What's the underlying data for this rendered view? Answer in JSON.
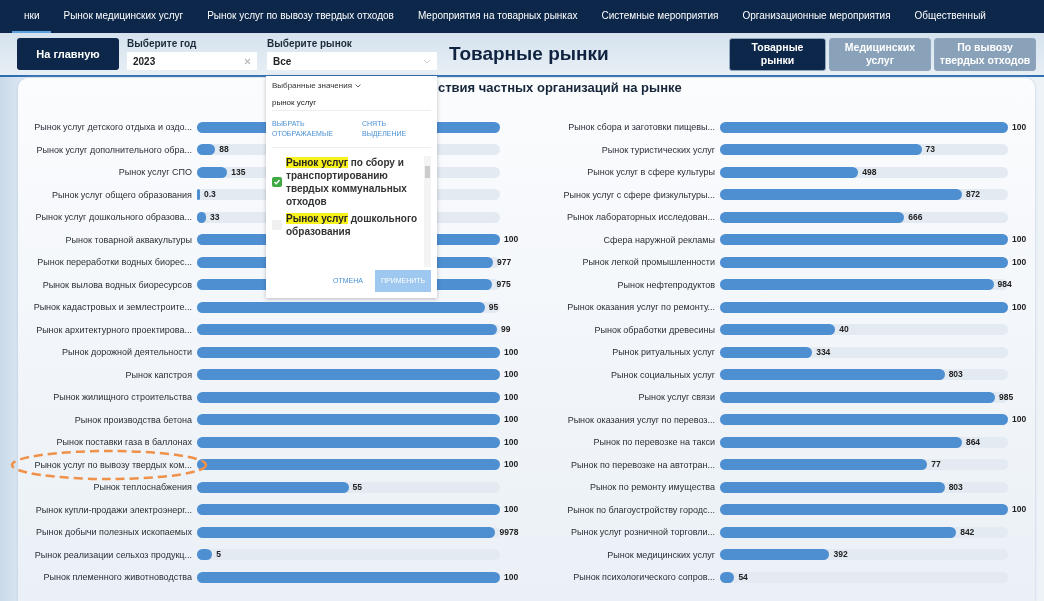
{
  "nav_tabs": [
    {
      "label": "нки",
      "selected": true
    },
    {
      "label": "Рынок медицинских услуг",
      "selected": false
    },
    {
      "label": "Рынок услуг по вывозу твердых отходов",
      "selected": false
    },
    {
      "label": "Мероприятия на товарных рынках",
      "selected": false
    },
    {
      "label": "Системные мероприятия",
      "selected": false
    },
    {
      "label": "Организационные мероприятия",
      "selected": false
    },
    {
      "label": "Общественный",
      "selected": false
    }
  ],
  "home_button": "На главную",
  "year_filter": {
    "label": "Выберите год",
    "value": "2023"
  },
  "market_filter": {
    "label": "Выберите рынок",
    "value": "Все"
  },
  "page_title": "Товарные рынки",
  "view_buttons": [
    {
      "label": "Товарные рынки",
      "selected": true
    },
    {
      "label": "Медицинских услуг",
      "selected": false
    },
    {
      "label": "По вывозу твердых отходов",
      "selected": false
    }
  ],
  "dropdown": {
    "mode": "Выбранные значения",
    "search": "рынок услуг",
    "select_visible": "ВЫБРАТЬ ОТОБРАЖАЕМЫЕ",
    "clear_selection": "СНЯТЬ ВЫДЕЛЕНИЕ",
    "options": [
      {
        "match": "Рынок услуг",
        "text": "по сбору и транспортированию твердых коммунальных отходов",
        "checked": true
      },
      {
        "match": "Рынок услуг",
        "text": "дошкольного образования",
        "checked": false
      }
    ],
    "cancel": "ОТМЕНА",
    "apply": "ПРИМЕНИТЬ",
    "apply_disabled": true
  },
  "chart": {
    "title": "ствия частных организаций на рынке",
    "left_rows": [
      {
        "label": "Рынок услуг детского отдыха и оздо...",
        "value": "",
        "level": 1,
        "highlighted": false
      },
      {
        "label": "Рынок услуг дополнительного обра...",
        "value": "88",
        "level": 0.06,
        "highlighted": false
      },
      {
        "label": "Рынок услуг СПО",
        "value": "135",
        "level": 0.1,
        "highlighted": false
      },
      {
        "label": "Рынок услуг общего образования",
        "value": "0.3",
        "level": 0.01,
        "highlighted": false
      },
      {
        "label": "Рынок услуг дошкольного образова...",
        "value": "33",
        "level": 0.03,
        "highlighted": false
      },
      {
        "label": "Рынок товарной аквакультуры",
        "value": "100",
        "level": 1,
        "highlighted": false
      },
      {
        "label": "Рынок переработки водных биорес...",
        "value": "977",
        "level": 0.977,
        "highlighted": false
      },
      {
        "label": "Рынок вылова водных биоресурсов",
        "value": "975",
        "level": 0.975,
        "highlighted": false
      },
      {
        "label": "Рынок кадастровых и землестроите...",
        "value": "95",
        "level": 0.95,
        "highlighted": false
      },
      {
        "label": "Рынок архитектурного проектирова...",
        "value": "99",
        "level": 0.99,
        "highlighted": false
      },
      {
        "label": "Рынок дорожной деятельности",
        "value": "100",
        "level": 1,
        "highlighted": false
      },
      {
        "label": "Рынок капстроя",
        "value": "100",
        "level": 1,
        "highlighted": false
      },
      {
        "label": "Рынок жилищного строительства",
        "value": "100",
        "level": 1,
        "highlighted": false
      },
      {
        "label": "Рынок производства бетона",
        "value": "100",
        "level": 1,
        "highlighted": false
      },
      {
        "label": "Рынок поставки газа в баллонах",
        "value": "100",
        "level": 1,
        "highlighted": false
      },
      {
        "label": "Рынок услуг по вывозу твердых ком...",
        "value": "100",
        "level": 1,
        "highlighted": true
      },
      {
        "label": "Рынок теплоснабжения",
        "value": "55",
        "level": 0.5,
        "highlighted": false
      },
      {
        "label": "Рынок купли-продажи электроэнерг...",
        "value": "100",
        "level": 1,
        "highlighted": false
      },
      {
        "label": "Рынок добычи полезных ископаемых",
        "value": "9978",
        "level": 0.985,
        "highlighted": false
      },
      {
        "label": "Рынок реализации сельхоз продукц...",
        "value": "5",
        "level": 0.05,
        "highlighted": false
      },
      {
        "label": "Рынок племенного животноводства",
        "value": "100",
        "level": 1,
        "highlighted": false
      }
    ],
    "right_rows": [
      {
        "label": "Рынок сбора и заготовки пищевы...",
        "value": "100",
        "level": 1
      },
      {
        "label": "Рынок туристических услуг",
        "value": "73",
        "level": 0.7
      },
      {
        "label": "Рынок услуг в сфере культуры",
        "value": "498",
        "level": 0.48
      },
      {
        "label": "Рынок услуг с сфере физкультуры...",
        "value": "872",
        "level": 0.84
      },
      {
        "label": "Рынок лабораторных исследован...",
        "value": "666",
        "level": 0.64
      },
      {
        "label": "Сфера наружной рекламы",
        "value": "100",
        "level": 1
      },
      {
        "label": "Рынок легкой промышленности",
        "value": "100",
        "level": 1
      },
      {
        "label": "Рынок нефтепродуктов",
        "value": "984",
        "level": 0.95
      },
      {
        "label": "Рынок оказания услуг по ремонту...",
        "value": "100",
        "level": 1
      },
      {
        "label": "Рынок обработки древесины",
        "value": "40",
        "level": 0.4
      },
      {
        "label": "Рынок ритуальных услуг",
        "value": "334",
        "level": 0.32
      },
      {
        "label": "Рынок социальных услуг",
        "value": "803",
        "level": 0.78
      },
      {
        "label": "Рынок услуг связи",
        "value": "985",
        "level": 0.955
      },
      {
        "label": "Рынок оказания услуг по перевоз...",
        "value": "100",
        "level": 1
      },
      {
        "label": "Рынок по перевозке на такси",
        "value": "864",
        "level": 0.84
      },
      {
        "label": "Рынок по перевозке на автотран...",
        "value": "77",
        "level": 0.72
      },
      {
        "label": "Рынок по ремонту имущества",
        "value": "803",
        "level": 0.78
      },
      {
        "label": "Рынок по благоустройству городс...",
        "value": "100",
        "level": 1
      },
      {
        "label": "Рынок услуг розничной торговли...",
        "value": "842",
        "level": 0.82
      },
      {
        "label": "Рынок медицинских услуг",
        "value": "392",
        "level": 0.38
      },
      {
        "label": "Рынок психологического сопров...",
        "value": "54",
        "level": 0.05
      }
    ]
  }
}
